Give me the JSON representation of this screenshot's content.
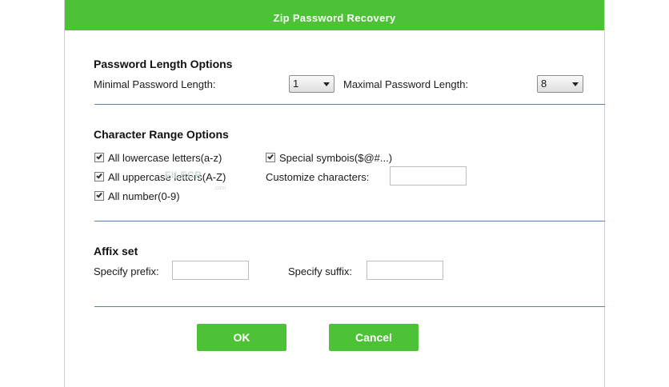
{
  "window": {
    "title": "Zip Password Recovery"
  },
  "length_options": {
    "heading": "Password Length Options",
    "min_label": "Minimal Password Length:",
    "min_value": "1",
    "max_label": "Maximal Password Length:",
    "max_value": "8"
  },
  "char_options": {
    "heading": "Character Range Options",
    "lowercase": {
      "label": "All lowercase letters(a-z)",
      "checked": true
    },
    "uppercase": {
      "label": "All uppercase letters(A-Z)",
      "checked": true
    },
    "numbers": {
      "label": "All number(0-9)",
      "checked": true
    },
    "special": {
      "label": "Special symbois($@#...)",
      "checked": true
    },
    "customize_label": "Customize characters:",
    "customize_value": ""
  },
  "affix": {
    "heading": "Affix set",
    "prefix_label": "Specify prefix:",
    "prefix_value": "",
    "suffix_label": "Specify suffix:",
    "suffix_value": ""
  },
  "buttons": {
    "ok": "OK",
    "cancel": "Cancel"
  },
  "watermark": {
    "text": "FILECR",
    "suffix": ".com"
  },
  "colors": {
    "accent": "#4dc236",
    "divider": "#5a7fa3"
  }
}
